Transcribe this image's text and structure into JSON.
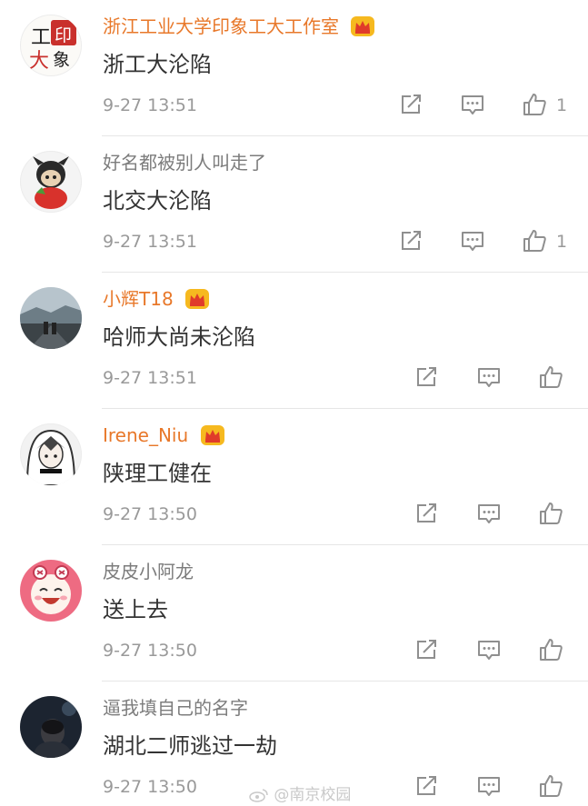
{
  "comments": [
    {
      "name": "浙江工业大学印象工大工作室",
      "vip": true,
      "verified": true,
      "text": "浙工大沦陷",
      "time": "9-27 13:51",
      "likes": "1",
      "avatar_chars": [
        "工",
        "印",
        "大",
        "象"
      ]
    },
    {
      "name": "好名都被别人叫走了",
      "vip": false,
      "verified": false,
      "text": "北交大沦陷",
      "time": "9-27 13:51",
      "likes": "1"
    },
    {
      "name": "小辉T18",
      "vip": true,
      "verified": false,
      "text": "哈师大尚未沦陷",
      "time": "9-27 13:51",
      "likes": ""
    },
    {
      "name": "Irene_Niu",
      "vip": true,
      "verified": false,
      "text": "陕理工健在",
      "time": "9-27 13:50",
      "likes": ""
    },
    {
      "name": "皮皮小阿龙",
      "vip": false,
      "verified": false,
      "text": "送上去",
      "time": "9-27 13:50",
      "likes": ""
    },
    {
      "name": "逼我填自己的名字",
      "vip": false,
      "verified": false,
      "text": "湖北二师逃过一劫",
      "time": "9-27 13:50",
      "likes": ""
    }
  ],
  "icons": {
    "share": "share-icon",
    "comment": "comment-icon",
    "like": "thumbs-up-icon",
    "crown": "crown-icon",
    "verified": "verified-icon"
  },
  "colors": {
    "vip_name": "#e8782a",
    "name": "#7c7c7c",
    "text": "#333333",
    "meta": "#999999",
    "crown": "#f6b91f"
  },
  "watermark": "@南京校园"
}
